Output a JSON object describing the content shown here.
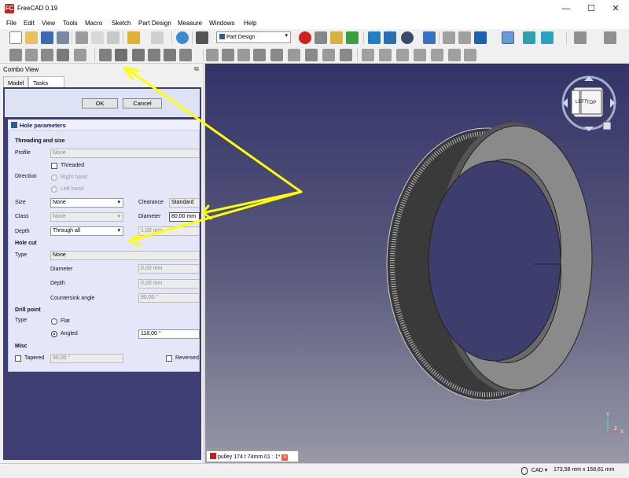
{
  "window": {
    "title": "FreeCAD 0.19",
    "app_icon": "FC",
    "minimize": "—",
    "maximize": "☐",
    "close": "✕"
  },
  "menu": [
    "File",
    "Edit",
    "View",
    "Tools",
    "Macro",
    "Sketch",
    "Part Design",
    "Measure",
    "Windows",
    "Help"
  ],
  "workbench": {
    "selected": "Part Design",
    "arrow": "▾"
  },
  "combo_view": {
    "title": "Combo View",
    "float_icon": "⧉",
    "tabs": {
      "model": "Model",
      "tasks": "Tasks"
    }
  },
  "task_buttons": {
    "ok": "OK",
    "cancel": "Cancel"
  },
  "hole": {
    "header": "Hole parameters",
    "threading": {
      "section": "Threading and size",
      "profile_label": "Profile",
      "profile_value": "None",
      "threaded_label": "Threaded",
      "threaded_checked": false,
      "direction_label": "Direction",
      "right_hand": "Right hand",
      "left_hand": "Left hand",
      "size_label": "Size",
      "size_value": "None",
      "clearance_label": "Clearance",
      "clearance_value": "Standard",
      "class_label": "Class",
      "class_value": "None",
      "diameter_label": "Diameter",
      "diameter_value": "80,00 mm",
      "depth_label": "Depth",
      "depth_value": "Through all",
      "depth_length": "1,00 mm"
    },
    "cut": {
      "section": "Hole cut",
      "type_label": "Type",
      "type_value": "None",
      "diameter_label": "Diameter",
      "diameter_value": "0,00 mm",
      "depth_label": "Depth",
      "depth_value": "0,00 mm",
      "countersink_label": "Countersink angle",
      "countersink_value": "90,00 °"
    },
    "drill": {
      "section": "Drill point",
      "type_label": "Type",
      "flat": "Flat",
      "angled": "Angled",
      "angled_selected": true,
      "angle_value": "118,00 °"
    },
    "misc": {
      "section": "Misc",
      "tapered_label": "Tapered",
      "tapered_checked": false,
      "tapered_value": "90,00 °",
      "reversed_label": "Reversed",
      "reversed_checked": false
    }
  },
  "navcube": {
    "left": "LEFT",
    "top": "TOP"
  },
  "document_tab": {
    "label": "pulley 174 t 74mm 01 : 1*"
  },
  "axis": {
    "y": "Y",
    "z": "Z",
    "x": "X"
  },
  "status": {
    "nav_style": "CAD",
    "dimensions": "173,58 mm x 158,61 mm"
  },
  "colors": {
    "viewport_top": "#333369",
    "viewport_bottom": "#9898a8",
    "annotation": "#ffff00",
    "panel": "#e3e7f8"
  }
}
